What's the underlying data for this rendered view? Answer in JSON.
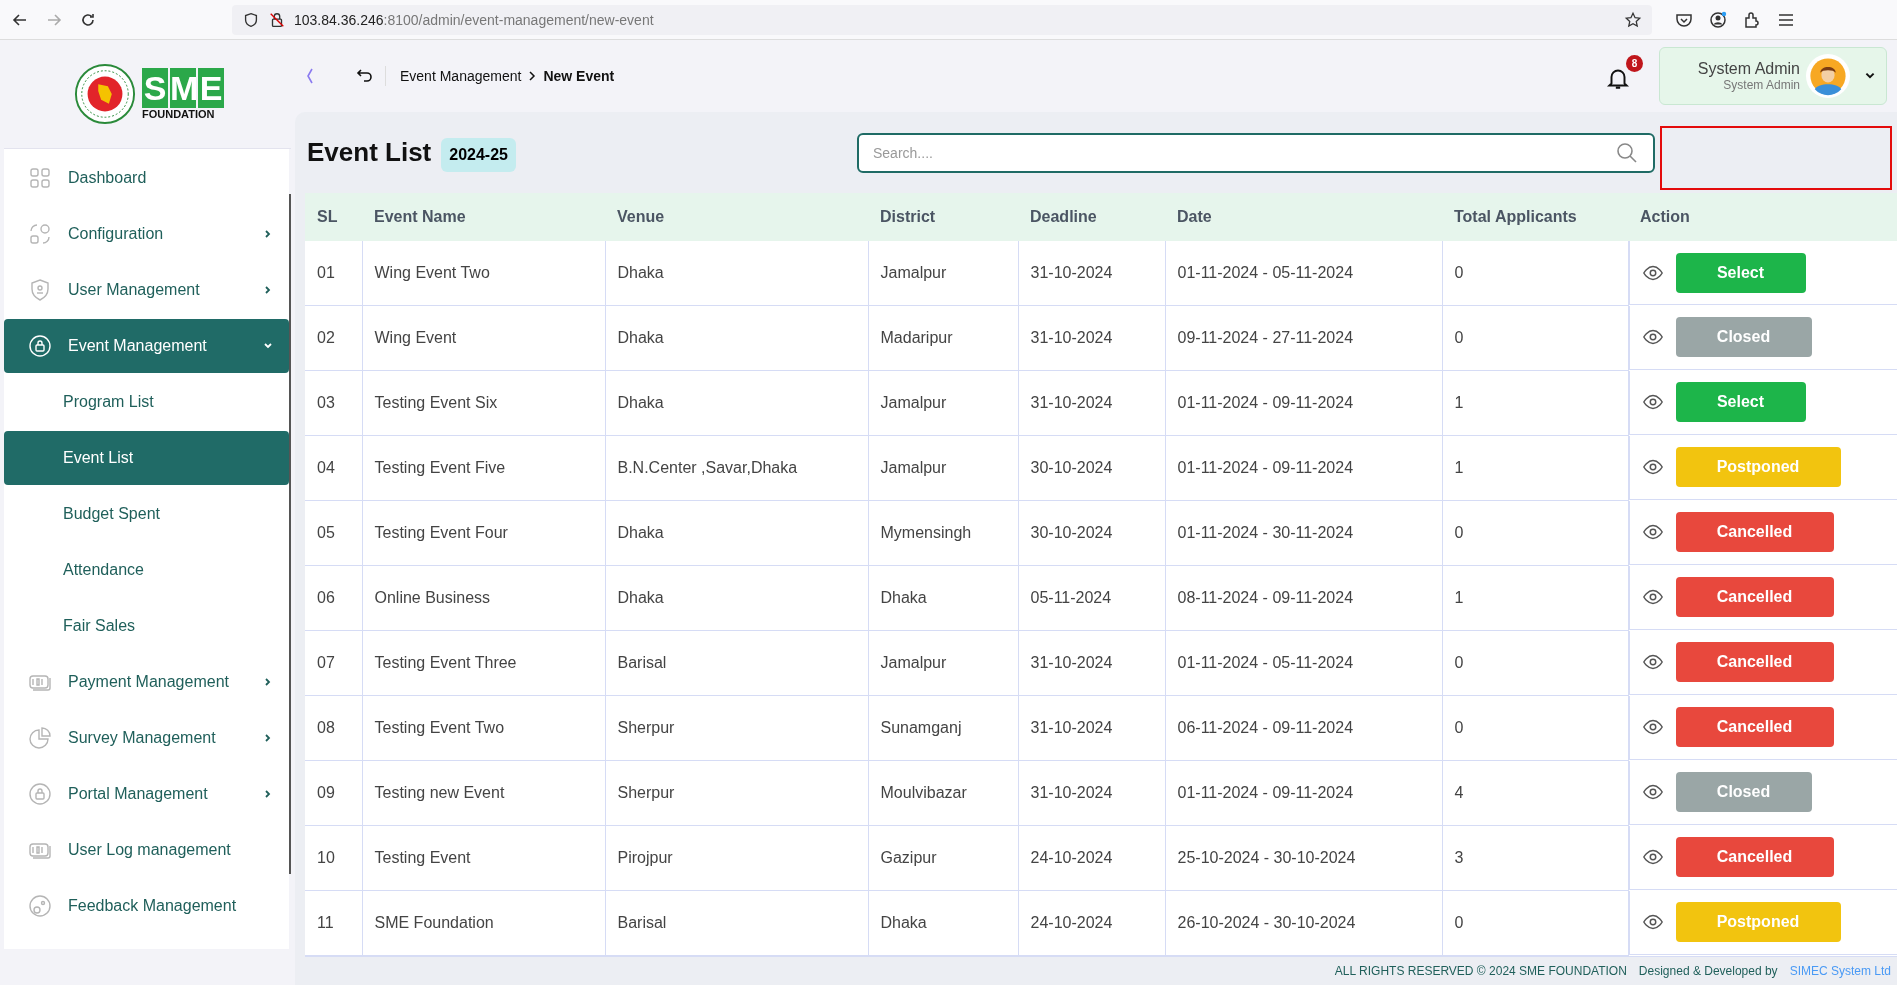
{
  "browser": {
    "url_host": "103.84.36.246",
    "url_path": ":8100/admin/event-management/new-event"
  },
  "logo": {
    "letters": [
      "S",
      "M",
      "E"
    ],
    "subtitle": "FOUNDATION"
  },
  "breadcrumb": [
    "Event Management",
    "New Event"
  ],
  "notifications": {
    "count": "8"
  },
  "user": {
    "name": "System Admin",
    "role": "System Admin"
  },
  "sidebar": {
    "items": [
      {
        "label": "Dashboard"
      },
      {
        "label": "Configuration",
        "expanded": false
      },
      {
        "label": "User Management",
        "expanded": false
      },
      {
        "label": "Event Management",
        "expanded": true,
        "selected": true,
        "children": [
          {
            "label": "Program List",
            "selected": false
          },
          {
            "label": "Event List",
            "selected": true
          },
          {
            "label": "Budget Spent",
            "selected": false
          },
          {
            "label": "Attendance",
            "selected": false
          },
          {
            "label": "Fair Sales",
            "selected": false
          }
        ]
      },
      {
        "label": "Payment Management",
        "expanded": false
      },
      {
        "label": "Survey Management",
        "expanded": false
      },
      {
        "label": "Portal Management",
        "expanded": false
      },
      {
        "label": "User Log management"
      },
      {
        "label": "Feedback Management"
      }
    ]
  },
  "page": {
    "title": "Event List",
    "badge": "2024-25",
    "search_placeholder": "Search...."
  },
  "table": {
    "columns": [
      "SL",
      "Event Name",
      "Venue",
      "District",
      "Deadline",
      "Date",
      "Total Applicants",
      "Action"
    ],
    "rows": [
      {
        "sl": "01",
        "name": "Wing Event Two",
        "venue": "Dhaka",
        "district": "Jamalpur",
        "deadline": "31-10-2024",
        "date": "01-11-2024 - 05-11-2024",
        "applicants": "0",
        "status": {
          "kind": "select",
          "label": "Select"
        }
      },
      {
        "sl": "02",
        "name": "Wing Event",
        "venue": "Dhaka",
        "district": "Madaripur",
        "deadline": "31-10-2024",
        "date": "09-11-2024 - 27-11-2024",
        "applicants": "0",
        "status": {
          "kind": "closed",
          "label": "Closed"
        }
      },
      {
        "sl": "03",
        "name": "Testing Event Six",
        "venue": "Dhaka",
        "district": "Jamalpur",
        "deadline": "31-10-2024",
        "date": "01-11-2024 - 09-11-2024",
        "applicants": "1",
        "status": {
          "kind": "select",
          "label": "Select"
        }
      },
      {
        "sl": "04",
        "name": "Testing Event Five",
        "venue": "B.N.Center ,Savar,Dhaka",
        "district": "Jamalpur",
        "deadline": "30-10-2024",
        "date": "01-11-2024 - 09-11-2024",
        "applicants": "1",
        "status": {
          "kind": "postponed",
          "label": "Postponed"
        }
      },
      {
        "sl": "05",
        "name": "Testing Event Four",
        "venue": "Dhaka",
        "district": "Mymensingh",
        "deadline": "30-10-2024",
        "date": "01-11-2024 - 30-11-2024",
        "applicants": "0",
        "status": {
          "kind": "cancelled",
          "label": "Cancelled"
        }
      },
      {
        "sl": "06",
        "name": "Online Business",
        "venue": "Dhaka",
        "district": "Dhaka",
        "deadline": "05-11-2024",
        "date": "08-11-2024 - 09-11-2024",
        "applicants": "1",
        "status": {
          "kind": "cancelled",
          "label": "Cancelled"
        }
      },
      {
        "sl": "07",
        "name": "Testing Event Three",
        "venue": "Barisal",
        "district": "Jamalpur",
        "deadline": "31-10-2024",
        "date": "01-11-2024 - 05-11-2024",
        "applicants": "0",
        "status": {
          "kind": "cancelled",
          "label": "Cancelled"
        }
      },
      {
        "sl": "08",
        "name": "Testing Event Two",
        "venue": "Sherpur",
        "district": "Sunamganj",
        "deadline": "31-10-2024",
        "date": "06-11-2024 - 09-11-2024",
        "applicants": "0",
        "status": {
          "kind": "cancelled",
          "label": "Cancelled"
        }
      },
      {
        "sl": "09",
        "name": "Testing new Event",
        "venue": "Sherpur",
        "district": "Moulvibazar",
        "deadline": "31-10-2024",
        "date": "01-11-2024 - 09-11-2024",
        "applicants": "4",
        "status": {
          "kind": "closed",
          "label": "Closed"
        }
      },
      {
        "sl": "10",
        "name": "Testing Event",
        "venue": "Pirojpur",
        "district": "Gazipur",
        "deadline": "24-10-2024",
        "date": "25-10-2024 - 30-10-2024",
        "applicants": "3",
        "status": {
          "kind": "cancelled",
          "label": "Cancelled"
        }
      },
      {
        "sl": "11",
        "name": "SME Foundation",
        "venue": "Barisal",
        "district": "Dhaka",
        "deadline": "24-10-2024",
        "date": "26-10-2024 - 30-10-2024",
        "applicants": "0",
        "status": {
          "kind": "postponed",
          "label": "Postponed"
        }
      }
    ]
  },
  "footer": {
    "rights": "ALL RIGHTS RESERVED © 2024 SME FOUNDATION",
    "credit": "Designed & Developed by",
    "developer": "SIMEC System Ltd"
  }
}
